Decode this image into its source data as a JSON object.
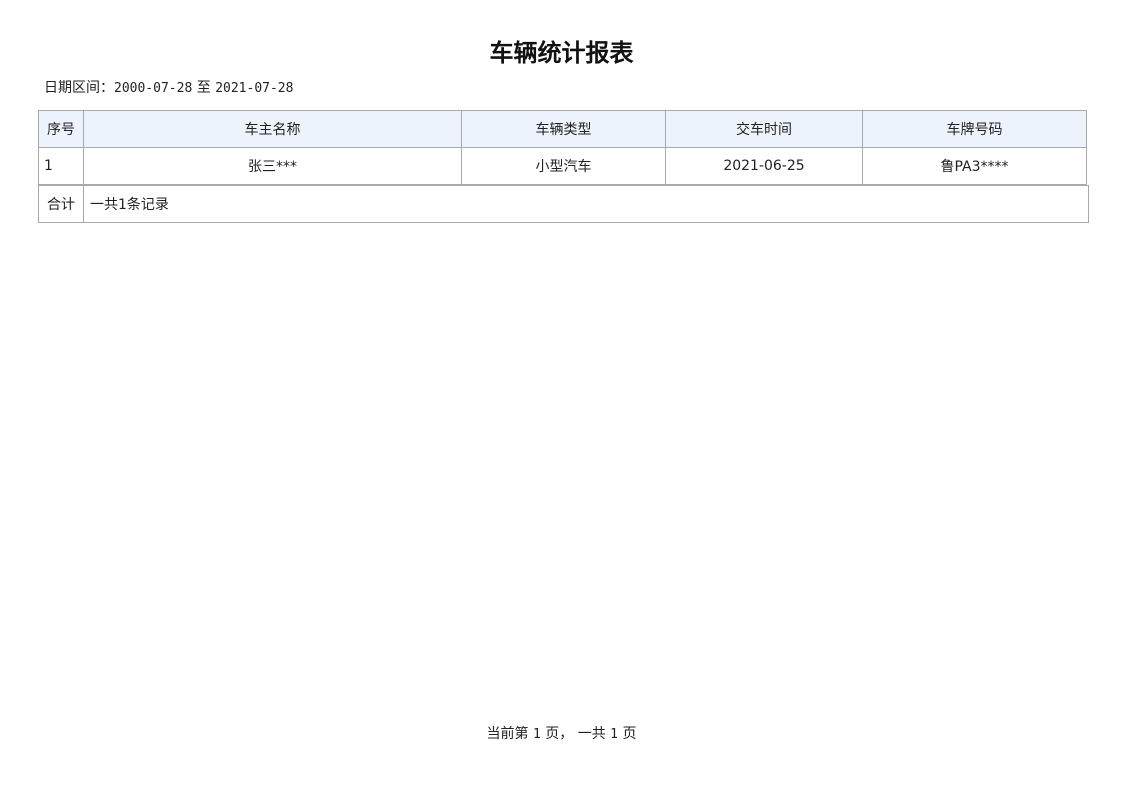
{
  "report": {
    "title": "车辆统计报表",
    "date_range": {
      "label": "日期区间：",
      "start": "2000-07-28",
      "separator": " 至 ",
      "end": "2021-07-28"
    },
    "table": {
      "headers": [
        "序号",
        "车主名称",
        "车辆类型",
        "交车时间",
        "车牌号码"
      ],
      "rows": [
        [
          "1",
          "张三***",
          "小型汽车",
          "2021-06-25",
          "鲁PA3****"
        ]
      ]
    },
    "summary": {
      "label": "合计",
      "text": "一共1条记录"
    },
    "footer": {
      "prefix": "当前第 ",
      "current_page": "1",
      "middle": " 页， 一共 ",
      "total_pages": "1",
      "suffix": " 页"
    }
  }
}
